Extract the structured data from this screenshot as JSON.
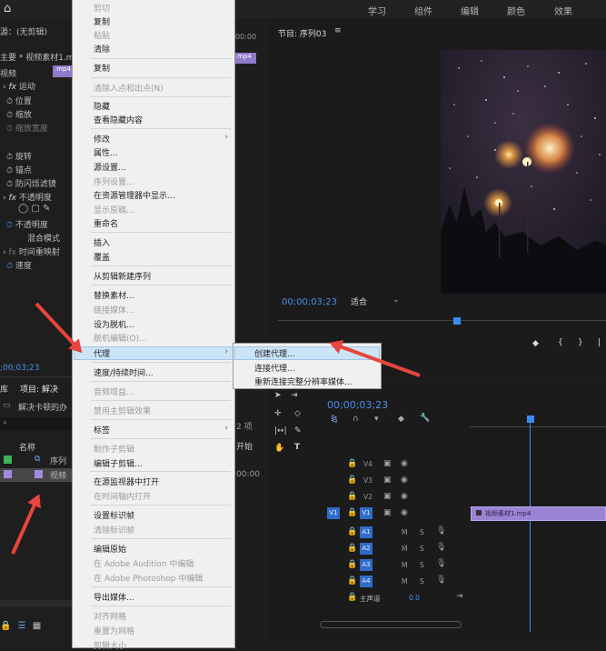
{
  "workspaces": [
    "学习",
    "组件",
    "编辑",
    "颜色",
    "效果"
  ],
  "effect_panel": {
    "source": "源：(无剪辑)",
    "master": "主要 * 视频素材1.mp4",
    "clip_tab": ".mp4",
    "section": "视频",
    "motion": "运动",
    "position": "位置",
    "scale": "缩放",
    "scale_width": "缩放宽度",
    "rotation": "旋转",
    "anchor": "锚点",
    "anti_flicker": "防闪烁滤镜",
    "opacity_fx": "不透明度",
    "opacity": "不透明度",
    "blend_mode": "混合模式",
    "time_remap": "时间重映射",
    "speed": "速度",
    "time_left": "00:00",
    "timecode": ";00;03;23"
  },
  "project_panel": {
    "tab_lib": "库",
    "tab_project": "项目: 解决",
    "bin_name": "解决卡顿的办",
    "column_name": "名称",
    "row1": "序列",
    "row2": "视频",
    "item_count": "2 项",
    "start_col": "开始",
    "start_val": "00:00"
  },
  "context_menu": {
    "items": [
      {
        "label": "剪切",
        "disabled": true
      },
      {
        "label": "复制",
        "disabled": false
      },
      {
        "label": "粘贴",
        "disabled": true
      },
      {
        "label": "清除",
        "disabled": false
      },
      {
        "label": "复制",
        "disabled": false
      },
      {
        "label": "清除入点和出点(N)",
        "disabled": true
      },
      {
        "label": "隐藏",
        "disabled": false
      },
      {
        "label": "查看隐藏内容",
        "disabled": false
      },
      {
        "label": "修改",
        "disabled": false
      },
      {
        "label": "属性...",
        "disabled": false
      },
      {
        "label": "源设置...",
        "disabled": false
      },
      {
        "label": "序列设置...",
        "disabled": true
      },
      {
        "label": "在资源管理器中显示...",
        "disabled": false
      },
      {
        "label": "显示原稿...",
        "disabled": true
      },
      {
        "label": "重命名",
        "disabled": false
      },
      {
        "label": "插入",
        "disabled": false
      },
      {
        "label": "覆盖",
        "disabled": false
      },
      {
        "label": "从剪辑新建序列",
        "disabled": false
      },
      {
        "label": "替换素材...",
        "disabled": false
      },
      {
        "label": "链接媒体...",
        "disabled": true
      },
      {
        "label": "设为脱机...",
        "disabled": false
      },
      {
        "label": "脱机编辑(O)...",
        "disabled": true
      },
      {
        "label": "代理",
        "disabled": false
      },
      {
        "label": "速度/持续时间...",
        "disabled": false
      },
      {
        "label": "音频增益...",
        "disabled": true
      },
      {
        "label": "禁用主剪辑效果",
        "disabled": true
      },
      {
        "label": "标签",
        "disabled": false
      },
      {
        "label": "制作子剪辑",
        "disabled": true
      },
      {
        "label": "编辑子剪辑...",
        "disabled": false
      },
      {
        "label": "在源监视器中打开",
        "disabled": false
      },
      {
        "label": "在时间轴内打开",
        "disabled": true
      },
      {
        "label": "设置标识帧",
        "disabled": false
      },
      {
        "label": "清除标识帧",
        "disabled": true
      },
      {
        "label": "编辑原始",
        "disabled": false
      },
      {
        "label": "在 Adobe Audition 中编辑",
        "disabled": true
      },
      {
        "label": "在 Adobe Photoshop 中编辑",
        "disabled": true
      },
      {
        "label": "导出媒体...",
        "disabled": false
      },
      {
        "label": "对齐网格",
        "disabled": true
      },
      {
        "label": "重置为网格",
        "disabled": true
      },
      {
        "label": "剪辑大小",
        "disabled": true
      }
    ]
  },
  "submenu": {
    "items": [
      "创建代理...",
      "连接代理...",
      "重新连接完整分辨率媒体..."
    ]
  },
  "program_monitor": {
    "title": "节目: 序列03",
    "timecode": "00;00;03;23",
    "fit": "适合"
  },
  "timeline": {
    "timecode": "00;00;03;23",
    "tracks_video": [
      "V4",
      "V3",
      "V2",
      "V1"
    ],
    "src_v1": "V1",
    "tracks_audio": [
      "A1",
      "A2",
      "A3",
      "A4"
    ],
    "master_track": "主声道",
    "master_value": "0.0",
    "clip_name": "视频素材1.mp4",
    "m_label": "M",
    "s_label": "S"
  },
  "colors": {
    "highlight": "#cce4f7",
    "audio_target": "#2f6cc9",
    "clip": "#9b84d4",
    "playhead": "#3b8cf0",
    "timecode": "#4b8fe8",
    "arrows": "#e8453c"
  }
}
